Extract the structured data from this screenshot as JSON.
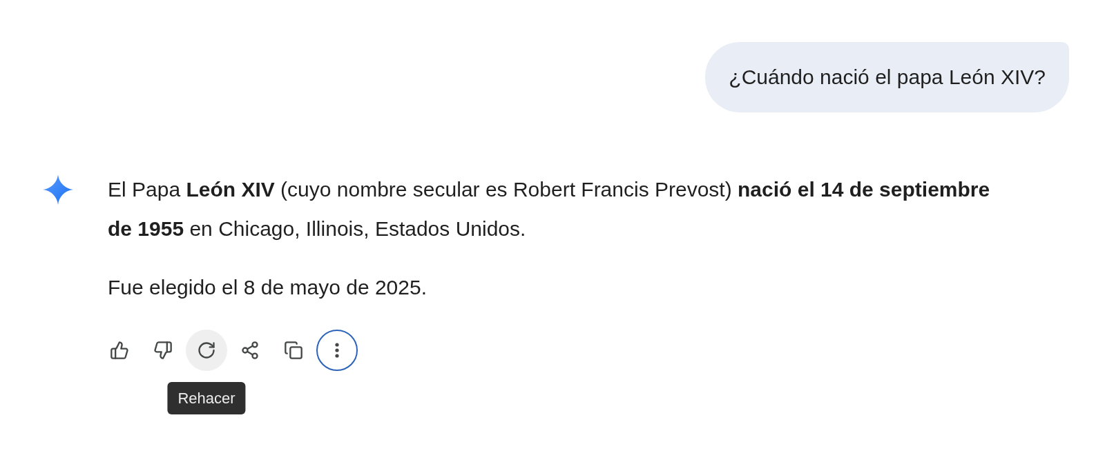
{
  "user_message": {
    "text": "¿Cuándo nació el papa León XIV?"
  },
  "response": {
    "paragraphs": [
      "El Papa **León XIV** (cuyo nombre secular es Robert Francis Prevost) **nació el 14 de septiembre de 1955** en Chicago, Illinois, Estados Unidos.",
      "Fue elegido el 8 de mayo de 2025."
    ]
  },
  "actions": [
    {
      "kind": "thumbs_up",
      "hovered": false,
      "focused": false
    },
    {
      "kind": "thumbs_down",
      "hovered": false,
      "focused": false
    },
    {
      "kind": "redo",
      "hovered": true,
      "focused": false,
      "tooltip": "Rehacer"
    },
    {
      "kind": "share",
      "hovered": false,
      "focused": false
    },
    {
      "kind": "copy",
      "hovered": false,
      "focused": false
    },
    {
      "kind": "more",
      "hovered": false,
      "focused": true
    }
  ]
}
